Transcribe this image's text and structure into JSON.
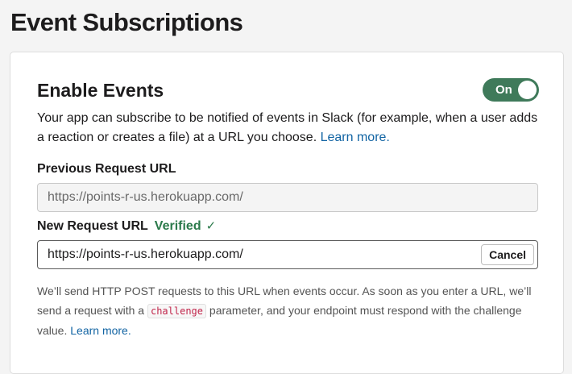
{
  "page": {
    "title": "Event Subscriptions"
  },
  "enable_events": {
    "title": "Enable Events",
    "toggle_label": "On",
    "toggle_state": "on",
    "toggle_color": "#3f7a5a",
    "description": "Your app can subscribe to be notified of events in Slack (for example, when a user adds a reaction or creates a file) at a URL you choose.",
    "learn_more": "Learn more."
  },
  "previous_url": {
    "label": "Previous Request URL",
    "value": "https://points-r-us.herokuapp.com/"
  },
  "new_url": {
    "label": "New Request URL",
    "status": "Verified",
    "status_icon": "checkmark-icon",
    "status_check": "✓",
    "value": "https://points-r-us.herokuapp.com/",
    "cancel_label": "Cancel"
  },
  "help": {
    "text_before": "We’ll send HTTP POST requests to this URL when events occur. As soon as you enter a URL, we’ll send a request with a",
    "code": "challenge",
    "text_after": "parameter, and your endpoint must respond with the challenge value.",
    "learn_more": "Learn more."
  },
  "colors": {
    "link": "#1264a3",
    "verified": "#2b7a4b",
    "code": "#c1244a"
  }
}
